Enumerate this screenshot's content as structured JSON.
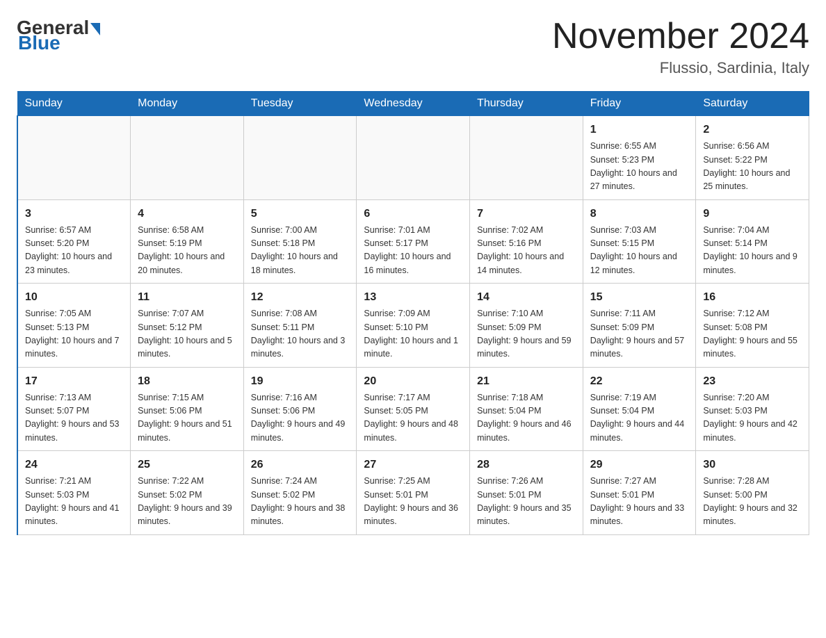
{
  "header": {
    "logo_general": "General",
    "logo_blue": "Blue",
    "month_title": "November 2024",
    "location": "Flussio, Sardinia, Italy"
  },
  "days_of_week": [
    "Sunday",
    "Monday",
    "Tuesday",
    "Wednesday",
    "Thursday",
    "Friday",
    "Saturday"
  ],
  "weeks": [
    [
      {
        "day": "",
        "sunrise": "",
        "sunset": "",
        "daylight": ""
      },
      {
        "day": "",
        "sunrise": "",
        "sunset": "",
        "daylight": ""
      },
      {
        "day": "",
        "sunrise": "",
        "sunset": "",
        "daylight": ""
      },
      {
        "day": "",
        "sunrise": "",
        "sunset": "",
        "daylight": ""
      },
      {
        "day": "",
        "sunrise": "",
        "sunset": "",
        "daylight": ""
      },
      {
        "day": "1",
        "sunrise": "Sunrise: 6:55 AM",
        "sunset": "Sunset: 5:23 PM",
        "daylight": "Daylight: 10 hours and 27 minutes."
      },
      {
        "day": "2",
        "sunrise": "Sunrise: 6:56 AM",
        "sunset": "Sunset: 5:22 PM",
        "daylight": "Daylight: 10 hours and 25 minutes."
      }
    ],
    [
      {
        "day": "3",
        "sunrise": "Sunrise: 6:57 AM",
        "sunset": "Sunset: 5:20 PM",
        "daylight": "Daylight: 10 hours and 23 minutes."
      },
      {
        "day": "4",
        "sunrise": "Sunrise: 6:58 AM",
        "sunset": "Sunset: 5:19 PM",
        "daylight": "Daylight: 10 hours and 20 minutes."
      },
      {
        "day": "5",
        "sunrise": "Sunrise: 7:00 AM",
        "sunset": "Sunset: 5:18 PM",
        "daylight": "Daylight: 10 hours and 18 minutes."
      },
      {
        "day": "6",
        "sunrise": "Sunrise: 7:01 AM",
        "sunset": "Sunset: 5:17 PM",
        "daylight": "Daylight: 10 hours and 16 minutes."
      },
      {
        "day": "7",
        "sunrise": "Sunrise: 7:02 AM",
        "sunset": "Sunset: 5:16 PM",
        "daylight": "Daylight: 10 hours and 14 minutes."
      },
      {
        "day": "8",
        "sunrise": "Sunrise: 7:03 AM",
        "sunset": "Sunset: 5:15 PM",
        "daylight": "Daylight: 10 hours and 12 minutes."
      },
      {
        "day": "9",
        "sunrise": "Sunrise: 7:04 AM",
        "sunset": "Sunset: 5:14 PM",
        "daylight": "Daylight: 10 hours and 9 minutes."
      }
    ],
    [
      {
        "day": "10",
        "sunrise": "Sunrise: 7:05 AM",
        "sunset": "Sunset: 5:13 PM",
        "daylight": "Daylight: 10 hours and 7 minutes."
      },
      {
        "day": "11",
        "sunrise": "Sunrise: 7:07 AM",
        "sunset": "Sunset: 5:12 PM",
        "daylight": "Daylight: 10 hours and 5 minutes."
      },
      {
        "day": "12",
        "sunrise": "Sunrise: 7:08 AM",
        "sunset": "Sunset: 5:11 PM",
        "daylight": "Daylight: 10 hours and 3 minutes."
      },
      {
        "day": "13",
        "sunrise": "Sunrise: 7:09 AM",
        "sunset": "Sunset: 5:10 PM",
        "daylight": "Daylight: 10 hours and 1 minute."
      },
      {
        "day": "14",
        "sunrise": "Sunrise: 7:10 AM",
        "sunset": "Sunset: 5:09 PM",
        "daylight": "Daylight: 9 hours and 59 minutes."
      },
      {
        "day": "15",
        "sunrise": "Sunrise: 7:11 AM",
        "sunset": "Sunset: 5:09 PM",
        "daylight": "Daylight: 9 hours and 57 minutes."
      },
      {
        "day": "16",
        "sunrise": "Sunrise: 7:12 AM",
        "sunset": "Sunset: 5:08 PM",
        "daylight": "Daylight: 9 hours and 55 minutes."
      }
    ],
    [
      {
        "day": "17",
        "sunrise": "Sunrise: 7:13 AM",
        "sunset": "Sunset: 5:07 PM",
        "daylight": "Daylight: 9 hours and 53 minutes."
      },
      {
        "day": "18",
        "sunrise": "Sunrise: 7:15 AM",
        "sunset": "Sunset: 5:06 PM",
        "daylight": "Daylight: 9 hours and 51 minutes."
      },
      {
        "day": "19",
        "sunrise": "Sunrise: 7:16 AM",
        "sunset": "Sunset: 5:06 PM",
        "daylight": "Daylight: 9 hours and 49 minutes."
      },
      {
        "day": "20",
        "sunrise": "Sunrise: 7:17 AM",
        "sunset": "Sunset: 5:05 PM",
        "daylight": "Daylight: 9 hours and 48 minutes."
      },
      {
        "day": "21",
        "sunrise": "Sunrise: 7:18 AM",
        "sunset": "Sunset: 5:04 PM",
        "daylight": "Daylight: 9 hours and 46 minutes."
      },
      {
        "day": "22",
        "sunrise": "Sunrise: 7:19 AM",
        "sunset": "Sunset: 5:04 PM",
        "daylight": "Daylight: 9 hours and 44 minutes."
      },
      {
        "day": "23",
        "sunrise": "Sunrise: 7:20 AM",
        "sunset": "Sunset: 5:03 PM",
        "daylight": "Daylight: 9 hours and 42 minutes."
      }
    ],
    [
      {
        "day": "24",
        "sunrise": "Sunrise: 7:21 AM",
        "sunset": "Sunset: 5:03 PM",
        "daylight": "Daylight: 9 hours and 41 minutes."
      },
      {
        "day": "25",
        "sunrise": "Sunrise: 7:22 AM",
        "sunset": "Sunset: 5:02 PM",
        "daylight": "Daylight: 9 hours and 39 minutes."
      },
      {
        "day": "26",
        "sunrise": "Sunrise: 7:24 AM",
        "sunset": "Sunset: 5:02 PM",
        "daylight": "Daylight: 9 hours and 38 minutes."
      },
      {
        "day": "27",
        "sunrise": "Sunrise: 7:25 AM",
        "sunset": "Sunset: 5:01 PM",
        "daylight": "Daylight: 9 hours and 36 minutes."
      },
      {
        "day": "28",
        "sunrise": "Sunrise: 7:26 AM",
        "sunset": "Sunset: 5:01 PM",
        "daylight": "Daylight: 9 hours and 35 minutes."
      },
      {
        "day": "29",
        "sunrise": "Sunrise: 7:27 AM",
        "sunset": "Sunset: 5:01 PM",
        "daylight": "Daylight: 9 hours and 33 minutes."
      },
      {
        "day": "30",
        "sunrise": "Sunrise: 7:28 AM",
        "sunset": "Sunset: 5:00 PM",
        "daylight": "Daylight: 9 hours and 32 minutes."
      }
    ]
  ]
}
